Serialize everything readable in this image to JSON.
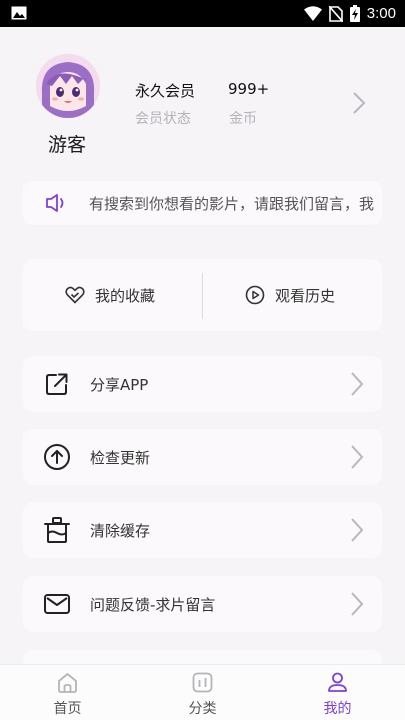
{
  "status_bar": {
    "time": "3:00"
  },
  "profile": {
    "name": "游客",
    "membership_value": "永久会员",
    "membership_label": "会员状态",
    "coins_value": "999+",
    "coins_label": "金币"
  },
  "notice": {
    "text": "有搜索到你想看的影片，请跟我们留言，我"
  },
  "quick_actions": [
    {
      "label": "我的收藏",
      "icon": "heart-icon"
    },
    {
      "label": "观看历史",
      "icon": "play-history-icon"
    }
  ],
  "menu": [
    {
      "label": "分享APP",
      "icon": "share-icon"
    },
    {
      "label": "检查更新",
      "icon": "update-icon"
    },
    {
      "label": "清除缓存",
      "icon": "trash-icon"
    },
    {
      "label": "问题反馈-求片留言",
      "icon": "mail-icon"
    }
  ],
  "bottom_nav": [
    {
      "label": "首页",
      "icon": "home-icon"
    },
    {
      "label": "分类",
      "icon": "category-icon"
    },
    {
      "label": "我的",
      "icon": "profile-icon",
      "active": true
    }
  ],
  "colors": {
    "accent": "#7b3fe4",
    "background": "#f6f4f7",
    "card": "#fbf9fb"
  }
}
